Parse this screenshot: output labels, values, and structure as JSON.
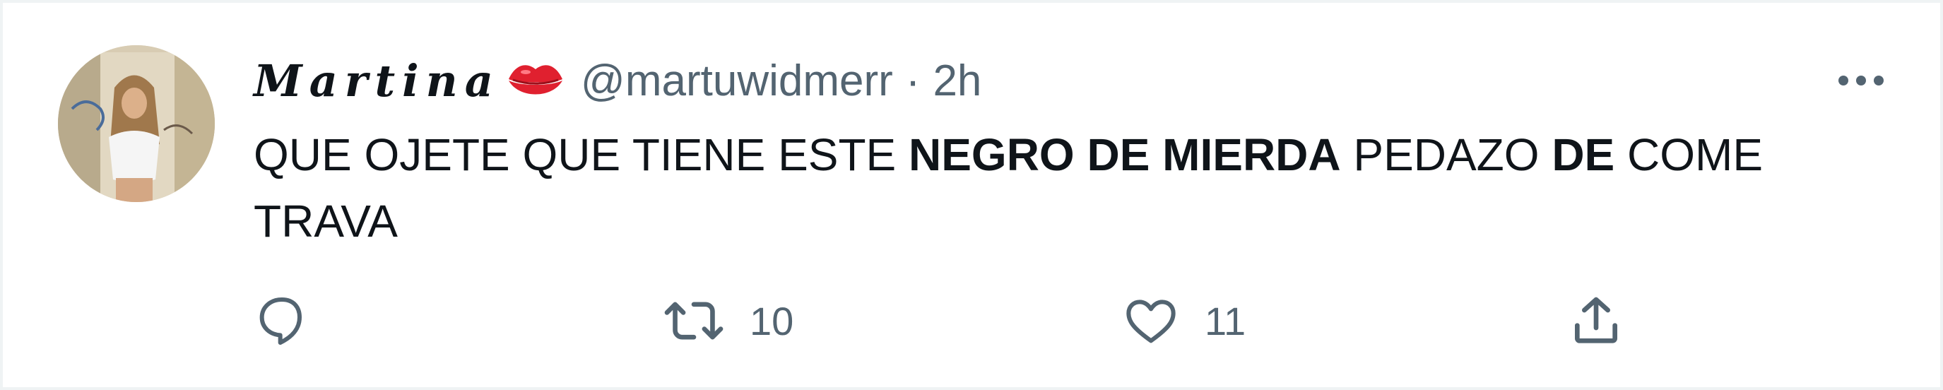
{
  "tweet": {
    "display_name": "Martina",
    "handle": "@martuwidmerr",
    "separator": "·",
    "time": "2h",
    "text_parts": [
      {
        "text": "QUE OJETE QUE TIENE ESTE ",
        "bold": false
      },
      {
        "text": "NEGRO DE MIERDA",
        "bold": true
      },
      {
        "text": " PEDAZO ",
        "bold": false
      },
      {
        "text": "DE",
        "bold": true
      },
      {
        "text": " COME TRAVA",
        "bold": false
      }
    ],
    "actions": {
      "reply_icon": "speech-bubble-icon",
      "retweet_icon": "retweet-arrows-icon",
      "retweet_count": "10",
      "like_icon": "heart-icon",
      "like_count": "11",
      "share_icon": "share-upload-icon"
    },
    "name_emoji_icon": "lips-icon",
    "more_icon": "ellipsis-icon"
  },
  "colors": {
    "text_primary": "#0f1419",
    "text_secondary": "#536471",
    "border": "#eff3f4",
    "lips_red": "#e0202f"
  }
}
